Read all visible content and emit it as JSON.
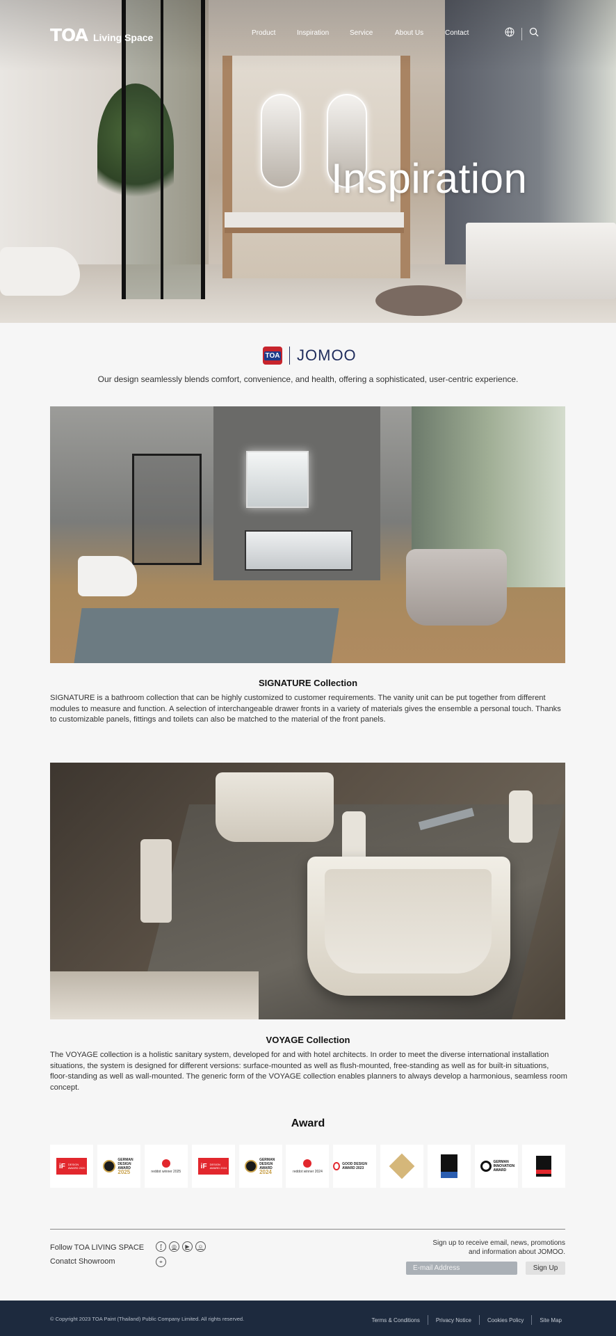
{
  "header": {
    "logo_mark": "TOA",
    "logo_text": "Living Space",
    "menu": [
      "Product",
      "Inspiration",
      "Service",
      "About Us",
      "Contact"
    ],
    "icons": [
      "globe-icon",
      "search-icon"
    ]
  },
  "hero": {
    "title": "Inspiration"
  },
  "brand": {
    "partner_badge": "TOA",
    "partner": "JOMOO"
  },
  "intro": "Our design seamlessly blends comfort, convenience, and health, offering a sophisticated, user-centric experience.",
  "collections": [
    {
      "title": "SIGNATURE Collection",
      "description": "SIGNATURE is a bathroom collection that can be highly customized to customer requirements. The vanity unit can be put together from different modules to measure and function. A selection of interchangeable drawer fronts in a variety of materials gives the ensemble a personal touch. Thanks to customizable panels, fittings and toilets can also be matched to the material of the front panels."
    },
    {
      "title": "VOYAGE Collection",
      "description": "The VOYAGE collection is a holistic sanitary system, developed for and with hotel architects. In order to meet the diverse international installation situations, the system is designed for different versions: surface-mounted as well as flush-mounted, free-standing as well as for built-in situations, floor-standing as well as wall-mounted. The generic form of the VOYAGE collection enables planners to always develop a harmonious, seamless room concept."
    }
  ],
  "awards": {
    "title": "Award",
    "badges": [
      {
        "kind": "if",
        "label": "iF",
        "sub": "DESIGN AWARD 2020"
      },
      {
        "kind": "german",
        "label": "GERMAN DESIGN AWARD",
        "year": "2025"
      },
      {
        "kind": "reddot",
        "label": "reddot winner 2025"
      },
      {
        "kind": "if",
        "label": "iF",
        "sub": "DESIGN AWARD 2024"
      },
      {
        "kind": "german",
        "label": "GERMAN DESIGN AWARD",
        "year": "2024"
      },
      {
        "kind": "reddot",
        "label": "reddot winner 2024"
      },
      {
        "kind": "good",
        "label": "GOOD DESIGN AWARD 2023"
      },
      {
        "kind": "diamond",
        "label": ""
      },
      {
        "kind": "black",
        "label": ""
      },
      {
        "kind": "inno",
        "label": "GERMAN INNOVATION AWARD"
      },
      {
        "kind": "black2",
        "label": ""
      }
    ]
  },
  "footer": {
    "follow": "Follow TOA LIVING SPACE",
    "showroom": "Conatct Showroom",
    "social_icons": [
      "facebook-icon",
      "instagram-icon",
      "youtube-icon",
      "line-icon"
    ],
    "signup_line1": "Sign up to receive email, news, promotions",
    "signup_line2": "and information about JOMOO.",
    "email_placeholder": "E-mail Address",
    "signup_button": "Sign Up",
    "copyright": "© Copyright 2023 TOA Paint (Thailand) Public Company Limited. All rights reserved.",
    "links": [
      "Terms & Conditions",
      "Privacy Notice",
      "Cookies Policy",
      "Site Map"
    ]
  }
}
